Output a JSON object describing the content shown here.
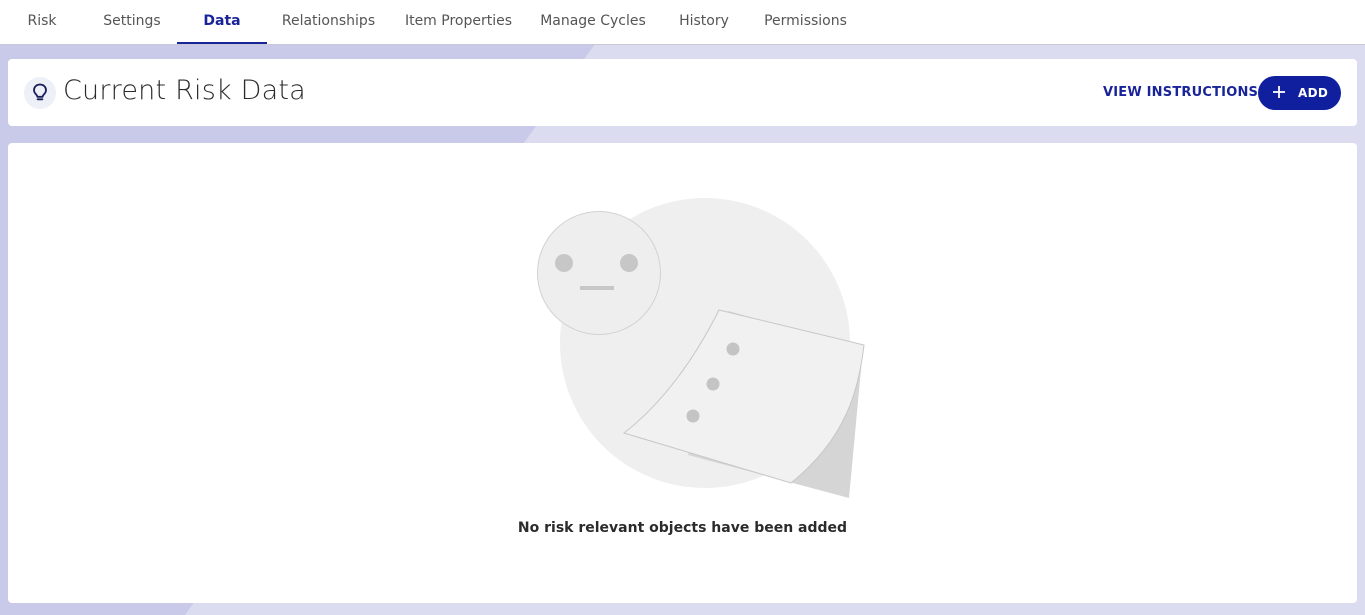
{
  "tabs": [
    {
      "label": "Risk",
      "active": false
    },
    {
      "label": "Settings",
      "active": false
    },
    {
      "label": "Data",
      "active": true
    },
    {
      "label": "Relationships",
      "active": false
    },
    {
      "label": "Item Properties",
      "active": false
    },
    {
      "label": "Manage Cycles",
      "active": false
    },
    {
      "label": "History",
      "active": false
    },
    {
      "label": "Permissions",
      "active": false
    }
  ],
  "header": {
    "icon": "lightbulb-icon",
    "title": "Current Risk Data",
    "view_instructions_label": "VIEW INSTRUCTIONS",
    "add_label": "ADD",
    "add_icon": "plus-icon"
  },
  "empty_state": {
    "message": "No risk relevant objects have been added"
  },
  "colors": {
    "accent": "#1a2499",
    "button": "#0f1f9e",
    "background": "#dcdcf0"
  }
}
